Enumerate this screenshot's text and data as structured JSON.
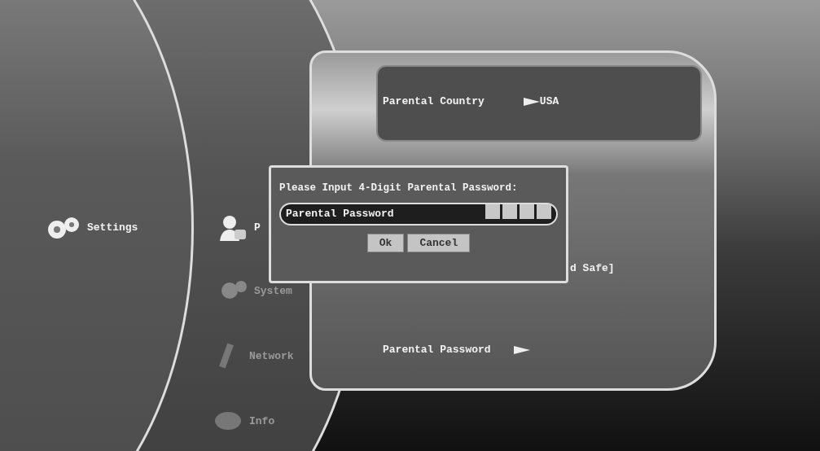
{
  "main_menu": {
    "label": "Settings"
  },
  "submenu": {
    "items": [
      {
        "label": "P",
        "kind": "parental",
        "selected": true
      },
      {
        "label": "System",
        "kind": "system",
        "selected": false
      },
      {
        "label": "Network",
        "kind": "network",
        "selected": false
      },
      {
        "label": "Info",
        "kind": "info",
        "selected": false
      }
    ]
  },
  "options": [
    {
      "kind": "value",
      "label": "Parental Country",
      "value": "USA",
      "selected": true
    },
    {
      "kind": "text",
      "label": "d Safe]",
      "selected": false
    },
    {
      "kind": "submenu",
      "label": "Parental Password",
      "selected": false
    }
  ],
  "dialog": {
    "title": "Please Input 4-Digit Parental Password:",
    "field_label": "Parental Password",
    "digit_boxes": [
      {
        "filled": false
      },
      {
        "filled": false
      },
      {
        "filled": false
      },
      {
        "filled": false
      }
    ],
    "buttons": [
      {
        "label": "Ok"
      },
      {
        "label": "Cancel"
      }
    ]
  }
}
